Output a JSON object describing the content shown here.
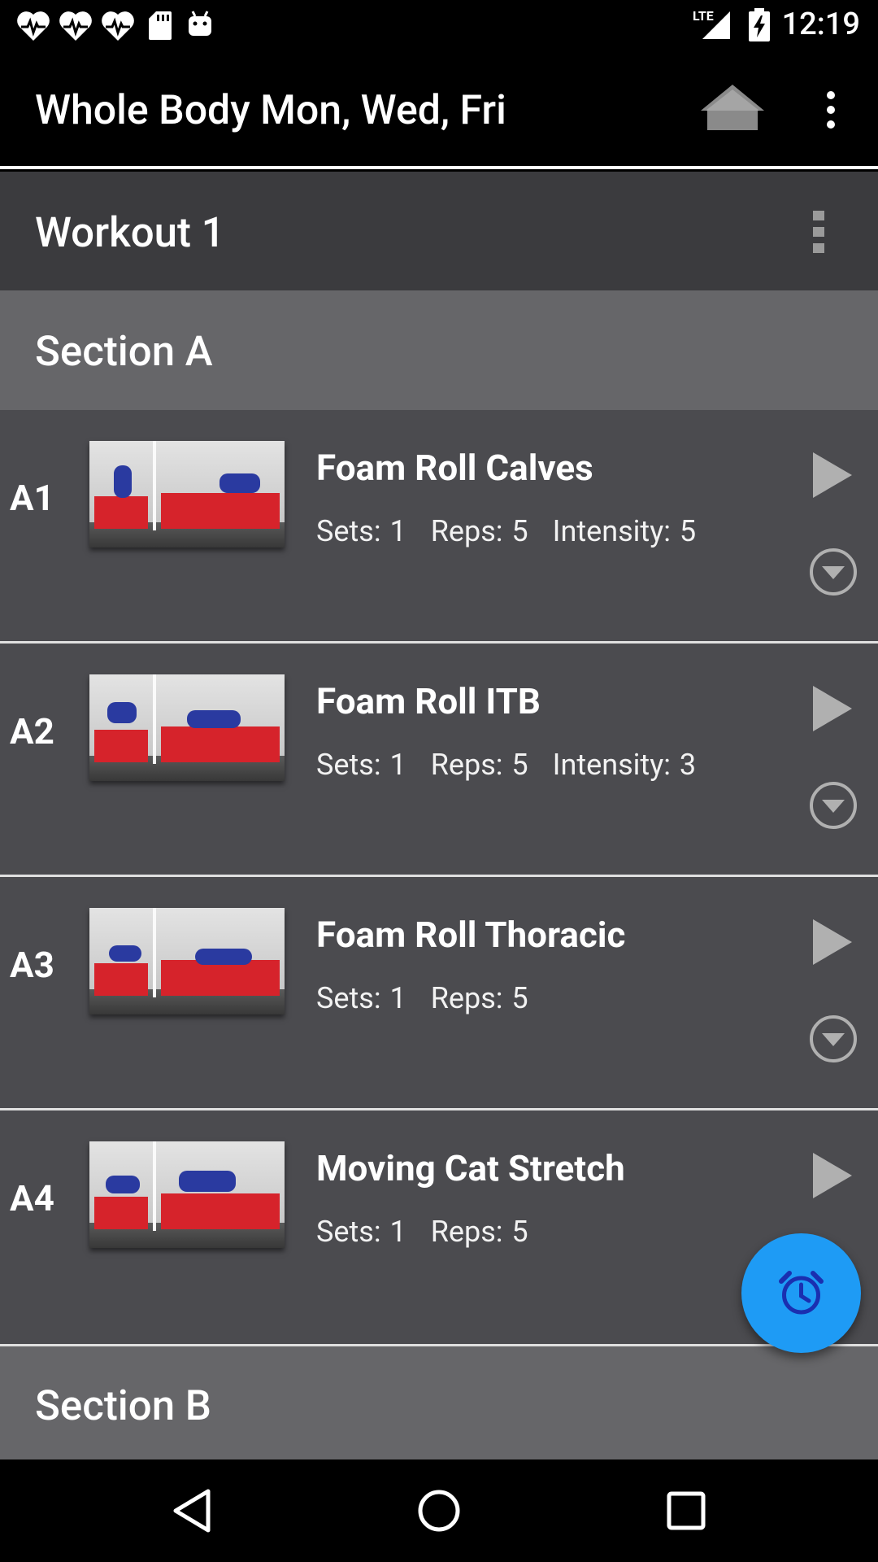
{
  "status_bar": {
    "time": "12:19",
    "network": "LTE",
    "icons": [
      "heart-pulse-icon",
      "heart-pulse-icon",
      "heart-pulse-icon",
      "sd-card-icon",
      "android-icon",
      "signal-icon",
      "battery-charging-icon"
    ]
  },
  "app_bar": {
    "title": "Whole Body Mon, Wed, Fri",
    "home_icon": "home-icon",
    "menu_icon": "more-vert-icon"
  },
  "workout": {
    "title": "Workout 1"
  },
  "sections": [
    {
      "title": "Section A",
      "exercises": [
        {
          "code": "A1",
          "name": "Foam Roll Calves",
          "sets": "Sets: 1",
          "reps": "Reps: 5",
          "intensity": "Intensity: 5"
        },
        {
          "code": "A2",
          "name": "Foam Roll ITB",
          "sets": "Sets: 1",
          "reps": "Reps: 5",
          "intensity": "Intensity: 3"
        },
        {
          "code": "A3",
          "name": "Foam Roll Thoracic",
          "sets": "Sets: 1",
          "reps": "Reps: 5",
          "intensity": ""
        },
        {
          "code": "A4",
          "name": "Moving Cat Stretch",
          "sets": "Sets: 1",
          "reps": "Reps: 5",
          "intensity": ""
        }
      ]
    },
    {
      "title": "Section B",
      "exercises": []
    }
  ],
  "fab": {
    "icon": "alarm-clock-icon",
    "color": "#1e9bf5"
  },
  "colors": {
    "background": "#4b4b4f",
    "workout_header": "#3b3b3e",
    "section_header": "#666669",
    "accent": "#1e9bf5"
  }
}
